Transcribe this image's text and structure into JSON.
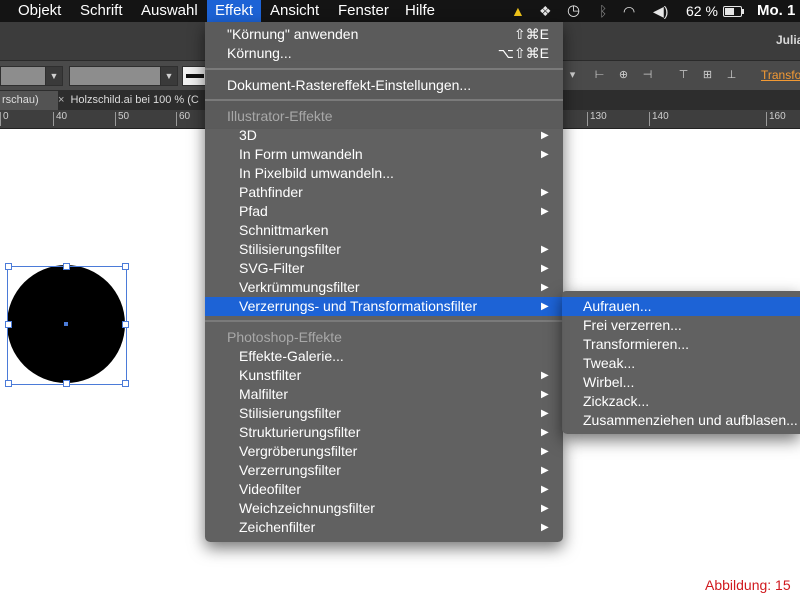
{
  "menubar": {
    "items": [
      "Objekt",
      "Schrift",
      "Auswahl",
      "Effekt",
      "Ansicht",
      "Fenster",
      "Hilfe"
    ],
    "active": "Effekt",
    "battery": "62 %",
    "clock": "Mo. 1"
  },
  "appbar": {
    "user": "Julia"
  },
  "controlbar": {
    "transform_link": "Transfo"
  },
  "tabs": [
    {
      "label": "rschau)"
    },
    {
      "close": "×",
      "label": "Holzschild.ai bei 100 % (C"
    }
  ],
  "ruler": {
    "ticks": [
      "0",
      "40",
      "50",
      "60",
      "130",
      "140",
      "160"
    ]
  },
  "effekt_menu": {
    "apply_last": {
      "label": "\"Körnung\" anwenden",
      "shortcut": "⇧⌘E"
    },
    "last_effect": {
      "label": "Körnung...",
      "shortcut": "⌥⇧⌘E"
    },
    "document_raster": "Dokument-Rastereffekt-Einstellungen...",
    "illustrator_header": "Illustrator-Effekte",
    "illustrator_items": [
      "3D",
      "In Form umwandeln",
      "In Pixelbild umwandeln...",
      "Pathfinder",
      "Pfad",
      "Schnittmarken",
      "Stilisierungsfilter",
      "SVG-Filter",
      "Verkrümmungsfilter",
      "Verzerrungs- und Transformationsfilter"
    ],
    "photoshop_header": "Photoshop-Effekte",
    "photoshop_items": [
      "Effekte-Galerie...",
      "Kunstfilter",
      "Malfilter",
      "Stilisierungsfilter",
      "Strukturierungsfilter",
      "Vergröberungsfilter",
      "Verzerrungsfilter",
      "Videofilter",
      "Weichzeichnungsfilter",
      "Zeichenfilter"
    ]
  },
  "submenu": {
    "items": [
      "Aufrauen...",
      "Frei verzerren...",
      "Transformieren...",
      "Tweak...",
      "Wirbel...",
      "Zickzack...",
      "Zusammenziehen und aufblasen..."
    ]
  },
  "caption": "Abbildung: 15",
  "colors": {
    "accent": "#1d63d6",
    "menu_bg": "#5c5c5c",
    "caption": "#d0191e",
    "selection": "#4b7bd8"
  },
  "icons": [
    "warning-icon",
    "dropbox-icon",
    "time-machine-icon",
    "bluetooth-icon",
    "wifi-icon",
    "volume-icon",
    "battery-icon",
    "submenu-arrow-icon"
  ]
}
